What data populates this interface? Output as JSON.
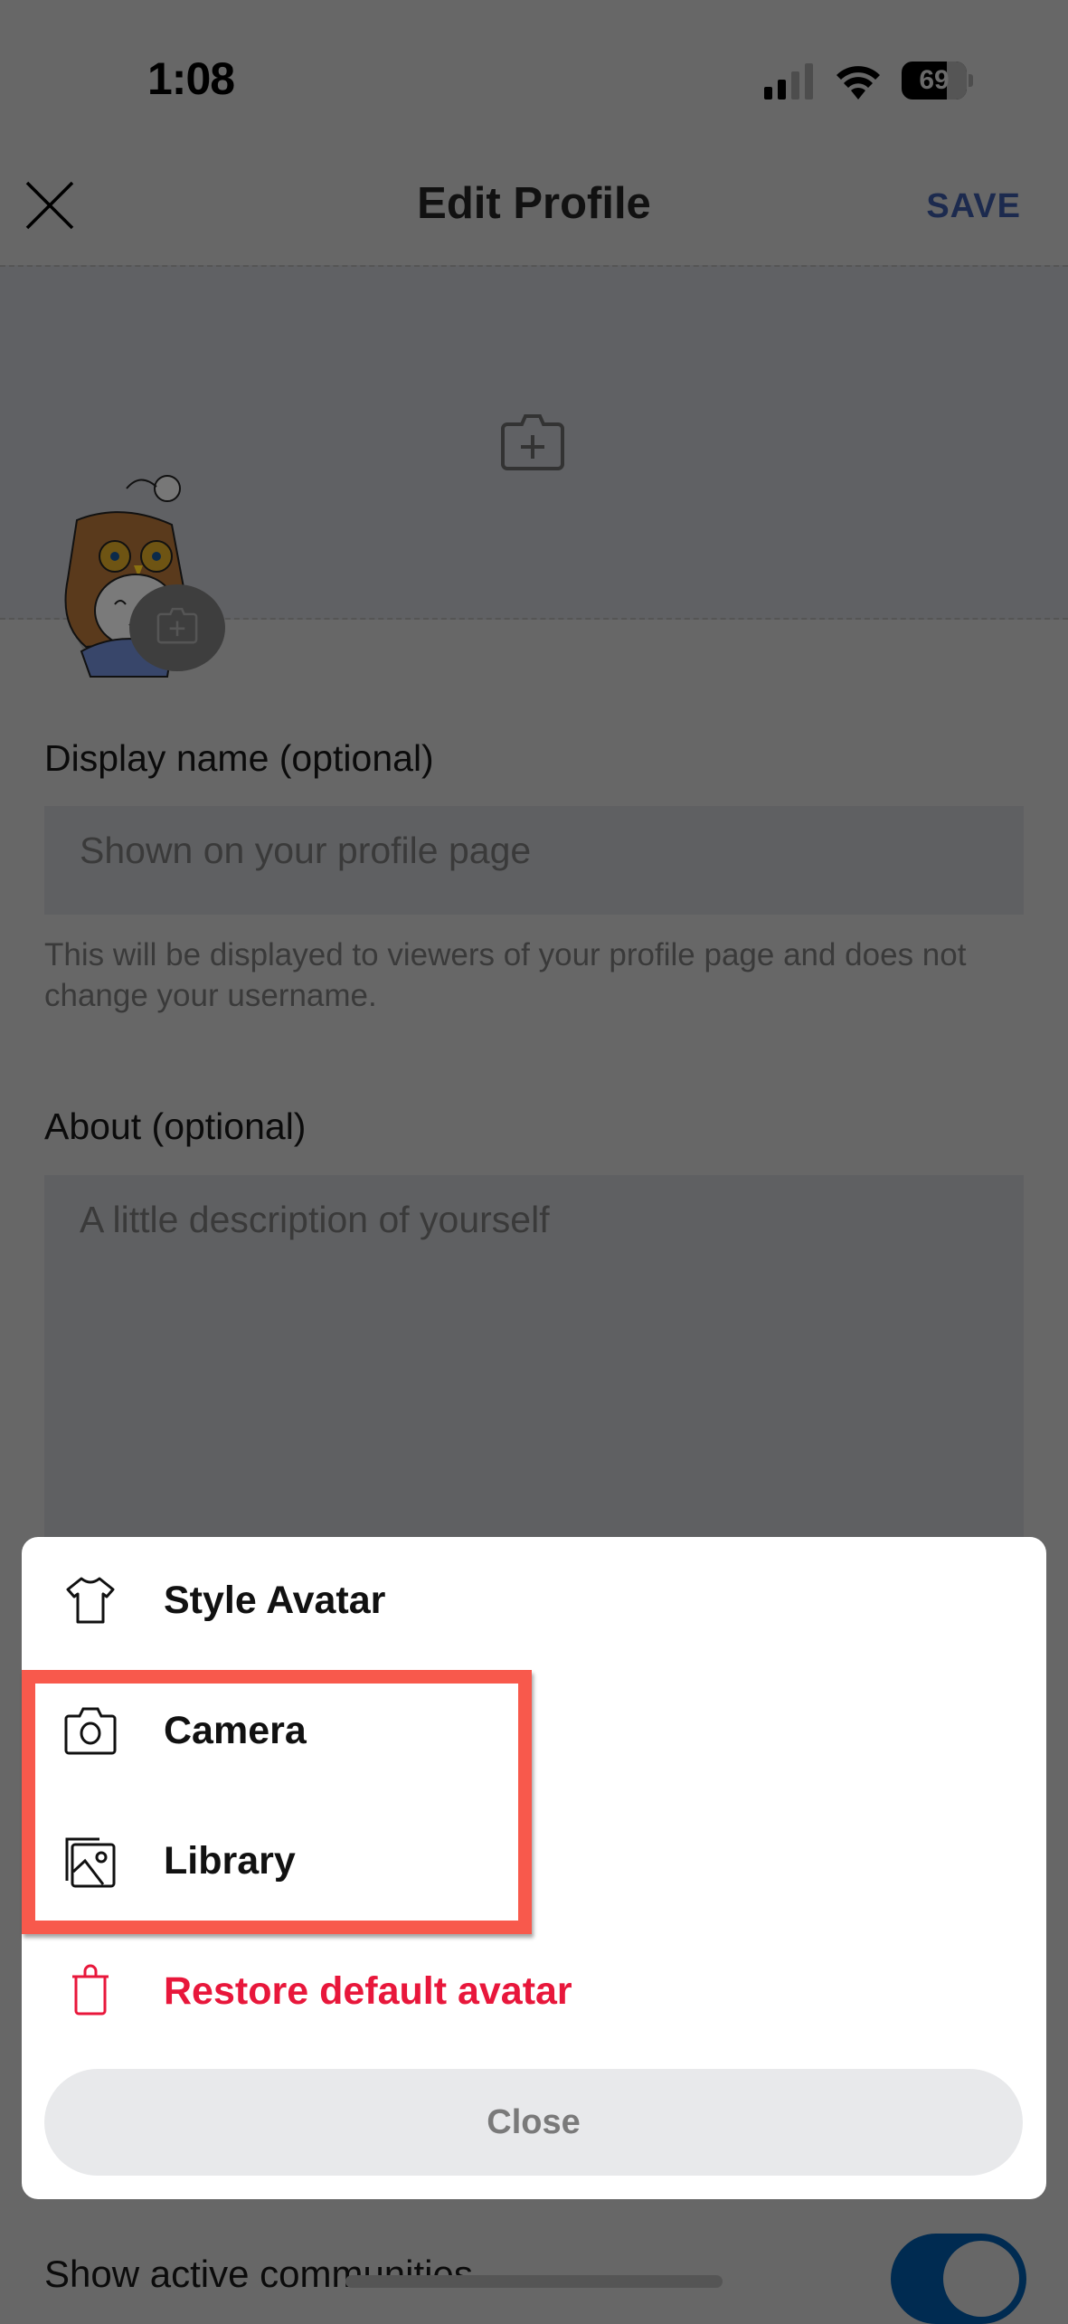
{
  "status_bar": {
    "time": "1:08",
    "battery": "69",
    "icons": [
      "signal-icon",
      "wifi-icon",
      "battery-icon"
    ]
  },
  "header": {
    "close_icon": "close-icon",
    "title": "Edit Profile",
    "save_label": "SAVE"
  },
  "banner": {
    "add_banner_icon": "add-photo-icon"
  },
  "avatar": {
    "edit_icon": "add-photo-icon"
  },
  "form": {
    "display_name": {
      "label": "Display name (optional)",
      "placeholder": "Shown on your profile page",
      "value": "",
      "hint": "This will be displayed to viewers of your profile page and does not change your username."
    },
    "about": {
      "label": "About (optional)",
      "placeholder": "A little description of yourself",
      "value": ""
    },
    "show_active_communities": {
      "label": "Show active communities",
      "enabled": true
    }
  },
  "action_sheet": {
    "items": [
      {
        "label": "Style Avatar",
        "icon": "tshirt-icon"
      },
      {
        "label": "Camera",
        "icon": "camera-icon"
      },
      {
        "label": "Library",
        "icon": "photo-library-icon"
      },
      {
        "label": "Restore default avatar",
        "icon": "trash-icon"
      }
    ],
    "close_label": "Close"
  },
  "colors": {
    "accent": "#1c2a4e",
    "danger": "#e8173b",
    "highlight": "#f8594c",
    "toggle_on": "#002b51"
  }
}
